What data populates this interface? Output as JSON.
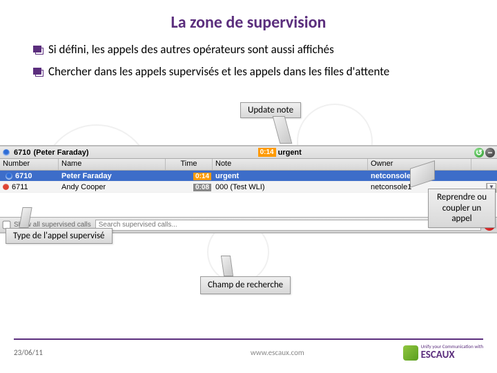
{
  "title": "La zone de supervision",
  "bullets": [
    "Si défini, les appels des autres opérateurs sont aussi affichés",
    "Chercher dans les appels supervisés et les appels dans les files d'attente"
  ],
  "callouts": {
    "update_note": "Update note",
    "reprendre": "Reprendre ou coupler un appel",
    "type_appel": "Type de l'appel supervisé",
    "champ_recherche": "Champ de recherche"
  },
  "supervision_panel": {
    "active_caller": {
      "id": "6710",
      "name": "(Peter Faraday)",
      "time": "0:14",
      "note": "urgent",
      "minus": "−"
    },
    "columns": {
      "number": "Number",
      "name": "Name",
      "time": "Time",
      "note": "Note",
      "owner": "Owner"
    },
    "rows": [
      {
        "icon": "blue",
        "number": "6710",
        "name": "Peter Faraday",
        "time": "0:14",
        "time_style": "orange",
        "note": "urgent",
        "owner": "netconsole1",
        "selected": true
      },
      {
        "icon": "red",
        "number": "6711",
        "name": "Andy Cooper",
        "time": "0:08",
        "time_style": "grey",
        "note": "000 (Test WLI)",
        "owner": "netconsole1",
        "selected": false
      }
    ],
    "checkbox_label": "Show all supervised calls",
    "search_placeholder": "Search supervised calls...",
    "clear": "✕"
  },
  "footer": {
    "date": "23/06/11",
    "url": "www.escaux.com",
    "brand": "ESCAUX",
    "tagline": "Unify your Communication with"
  }
}
